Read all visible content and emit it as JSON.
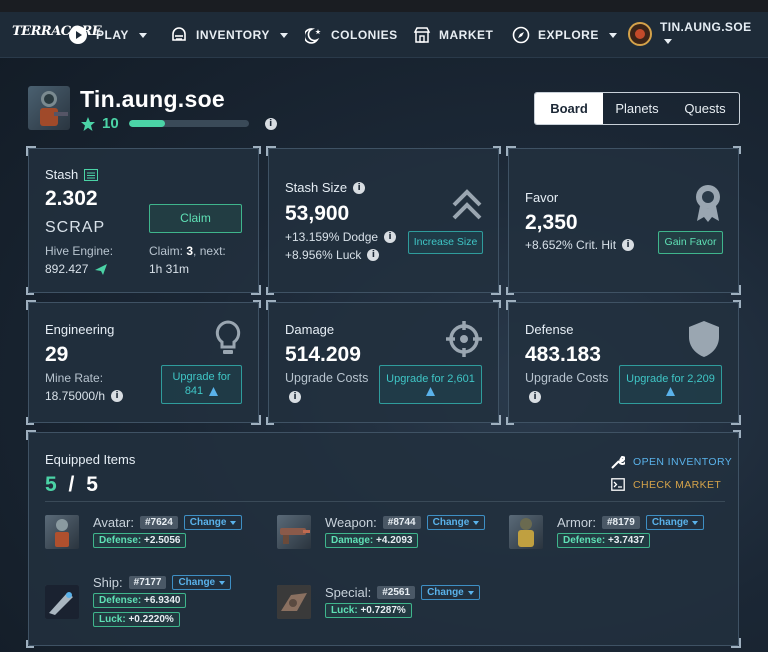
{
  "nav": {
    "logo": "TERRACORE",
    "play": "PLAY",
    "inventory": "INVENTORY",
    "colonies": "COLONIES",
    "market": "MARKET",
    "explore": "EXPLORE",
    "username": "TIN.AUNG.SOE"
  },
  "profile": {
    "name": "Tin.aung.soe",
    "level": "10",
    "xp_fraction": 0.3
  },
  "tabs": {
    "board": "Board",
    "planets": "Planets",
    "quests": "Quests"
  },
  "stash": {
    "title": "Stash",
    "amount": "2.302",
    "unit": "SCRAP",
    "claim_button": "Claim",
    "hive_label": "Hive Engine:",
    "hive_value": "892.427",
    "claim_label": "Claim:",
    "claim_count": "3",
    "next_label": ", next:",
    "next_time": "1h 31m"
  },
  "stash_size": {
    "title": "Stash Size",
    "value": "53,900",
    "dodge": "+13.159% Dodge",
    "luck": "+8.956% Luck",
    "button": "Increase Size"
  },
  "favor": {
    "title": "Favor",
    "value": "2,350",
    "crit": "+8.652% Crit. Hit",
    "button": "Gain Favor"
  },
  "engineering": {
    "title": "Engineering",
    "value": "29",
    "rate_label": "Mine Rate:",
    "rate_value": "18.75000/h",
    "button_line1": "Upgrade for",
    "button_line2": "841"
  },
  "damage": {
    "title": "Damage",
    "value": "514.209",
    "costs_label": "Upgrade Costs",
    "button": "Upgrade for 2,601"
  },
  "defense": {
    "title": "Defense",
    "value": "483.183",
    "costs_label": "Upgrade Costs",
    "button": "Upgrade for 2,209"
  },
  "equipped": {
    "title": "Equipped Items",
    "count": "5",
    "sep": "/",
    "total": "5",
    "open_inventory": "OPEN INVENTORY",
    "check_market": "CHECK MARKET",
    "change_label": "Change",
    "avatar": {
      "label": "Avatar:",
      "id": "#7624",
      "stat_key": "Defense:",
      "stat_val": "+2.5056"
    },
    "weapon": {
      "label": "Weapon:",
      "id": "#8744",
      "stat_key": "Damage:",
      "stat_val": "+4.2093"
    },
    "armor": {
      "label": "Armor:",
      "id": "#8179",
      "stat_key": "Defense:",
      "stat_val": "+3.7437"
    },
    "ship": {
      "label": "Ship:",
      "id": "#7177",
      "stat1_key": "Defense:",
      "stat1_val": "+6.9340",
      "stat2_key": "Luck:",
      "stat2_val": "+0.2220%"
    },
    "special": {
      "label": "Special:",
      "id": "#2561",
      "stat_key": "Luck:",
      "stat_val": "+0.7287%"
    }
  },
  "colors": {
    "accent": "#4bd3a6",
    "blue": "#5ab2ea",
    "gold": "#d4a24a"
  }
}
